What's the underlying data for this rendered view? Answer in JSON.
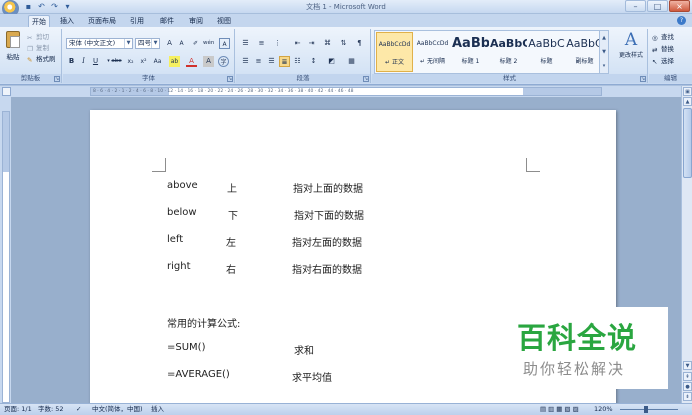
{
  "window": {
    "title": "文档 1 - Microsoft Word",
    "controls": {
      "minimize": "–",
      "maximize": "□",
      "close": "×"
    }
  },
  "quick_access": [
    "save-icon",
    "undo-icon",
    "redo-icon",
    "customize-icon"
  ],
  "tabs": [
    {
      "label": "开始",
      "active": true
    },
    {
      "label": "插入"
    },
    {
      "label": "页面布局"
    },
    {
      "label": "引用"
    },
    {
      "label": "邮件"
    },
    {
      "label": "审阅"
    },
    {
      "label": "视图"
    }
  ],
  "ribbon": {
    "clipboard": {
      "label": "剪贴板",
      "paste": "粘贴",
      "cut": "剪切",
      "copy": "复制",
      "format_painter": "格式刷"
    },
    "font": {
      "label": "字体",
      "font_name": "宋体 (中文正文)",
      "font_size": "四号",
      "grow": "A",
      "shrink": "A",
      "bold": "B",
      "italic": "I",
      "underline": "U",
      "strike": "abe",
      "subscript": "x₂",
      "superscript": "x²",
      "change_case": "Aa",
      "highlight": "ab",
      "font_color": "A",
      "char_border": "A",
      "phonetic": "wén",
      "enclose": "字"
    },
    "paragraph": {
      "label": "段落"
    },
    "styles": {
      "label": "样式",
      "items": [
        {
          "preview": "AaBbCcDd",
          "name": "↵ 正文",
          "selected": true
        },
        {
          "preview": "AaBbCcDd",
          "name": "↵ 无间隔"
        },
        {
          "preview": "AaBb",
          "name": "标题 1"
        },
        {
          "preview": "AaBbC",
          "name": "标题 2"
        },
        {
          "preview": "AaBbC",
          "name": "标题"
        },
        {
          "preview": "AaBbC",
          "name": "副标题"
        }
      ],
      "change_styles": "更改样式"
    },
    "editing": {
      "label": "编辑",
      "find": "查找",
      "replace": "替换",
      "select": "选择"
    }
  },
  "ruler": {
    "ticks": "8 · 6 · 4 · 2 · 1 · 2 · 4 · 6 · 8 · 10 · 12 · 14 · 16 · 18 · 20 · 22 · 24 · 26 · 28 · 30 · 32 · 34 · 36 · 38 · 40 · 42 · 44 · 46 · 48"
  },
  "document": {
    "lines": [
      {
        "c1": "above",
        "c2": "上",
        "c3": "指对上面的数据"
      },
      {
        "c1": "below",
        "c2": "下",
        "c3": "指对下面的数据"
      },
      {
        "c1": "left",
        "c2": "左",
        "c3": "指对左面的数据"
      },
      {
        "c1": "right",
        "c2": "右",
        "c3": "指对右面的数据"
      }
    ],
    "formula_heading": "常用的计算公式:",
    "formulas": [
      {
        "expr": "=SUM()",
        "desc": "求和"
      },
      {
        "expr": "=AVERAGE()",
        "desc": "求平均值"
      }
    ]
  },
  "watermark": {
    "main": "百科全说",
    "sub": "助你轻松解决"
  },
  "status": {
    "page": "页面: 1/1",
    "words": "字数: 52",
    "language": "中文(简体，中国)",
    "insert_mode": "插入",
    "zoom": "120%"
  }
}
